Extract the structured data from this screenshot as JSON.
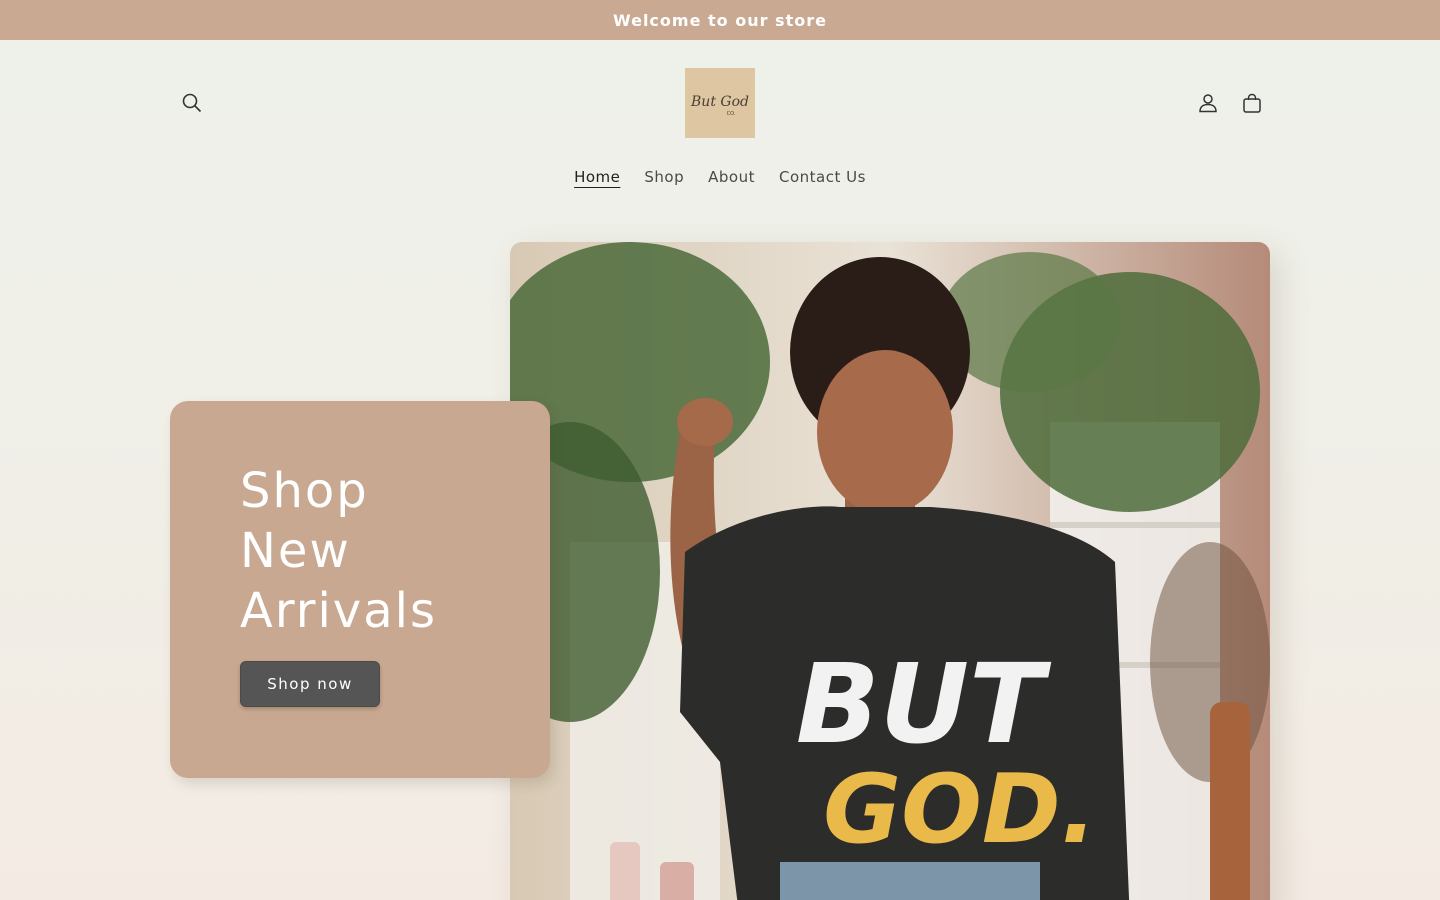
{
  "announcement": {
    "text": "Welcome to our store"
  },
  "header": {
    "logo": {
      "line1": "But God",
      "line2": "CO."
    },
    "icons": {
      "search": "search-icon",
      "account": "account-icon",
      "cart": "cart-icon"
    }
  },
  "nav": {
    "items": [
      {
        "label": "Home",
        "active": true
      },
      {
        "label": "Shop",
        "active": false
      },
      {
        "label": "About",
        "active": false
      },
      {
        "label": "Contact Us",
        "active": false
      }
    ]
  },
  "hero": {
    "heading_lines": [
      "Shop",
      "New",
      "Arrivals"
    ],
    "button_label": "Shop now",
    "shirt_text": {
      "line1": "BUT",
      "line2": "GOD."
    }
  },
  "colors": {
    "announcement_bg": "#c9a992",
    "card_bg": "#c8a890",
    "button_bg": "#555555",
    "logo_bg": "#dfc6a2",
    "shirt_accent": "#e9b949"
  }
}
